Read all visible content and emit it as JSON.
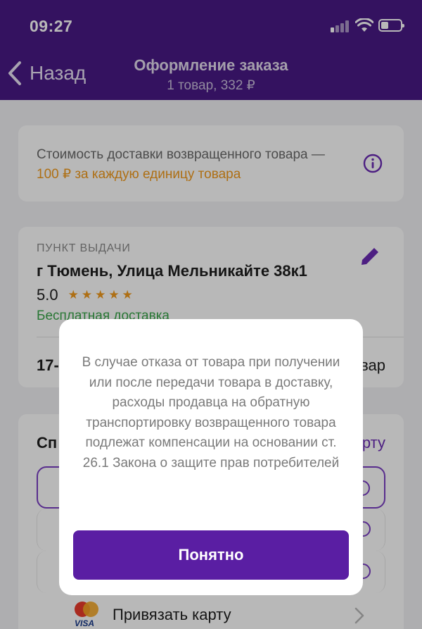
{
  "status_bar": {
    "time": "09:27",
    "icons": [
      "cellular-signal-icon",
      "wifi-icon",
      "battery-icon"
    ]
  },
  "nav": {
    "back_label": "Назад",
    "title": "Оформление заказа",
    "subtitle": "1 товар, 332 ₽"
  },
  "delivery_notice": {
    "text": "Стоимость доставки возвращенного товара — ",
    "highlight": "100 ₽ за каждую единицу товара"
  },
  "pickup_point": {
    "label": "ПУНКТ ВЫДАЧИ",
    "address": "г Тюмень, Улица Мельникайте 38к1",
    "rating": "5.0",
    "stars": "★★★★★",
    "free_delivery": "Бесплатная доставка",
    "date": "17-",
    "items": "вар"
  },
  "payment": {
    "title": "Сп",
    "link": "рту",
    "add_card_label": "Привязать карту",
    "card_brand": "VISA"
  },
  "modal": {
    "text": "В случае отказа от товара при получении или после передачи товара в доставку, расходы продавца на обратную транспортировку возвращенного товара подлежат компенсации на основании ст. 26.1 Закона о защите прав потребителей",
    "button_label": "Понятно"
  },
  "colors": {
    "brand": "#481a86",
    "button": "#5a1ea3",
    "accent_orange": "#f19a1c",
    "success_green": "#3aa64a"
  }
}
